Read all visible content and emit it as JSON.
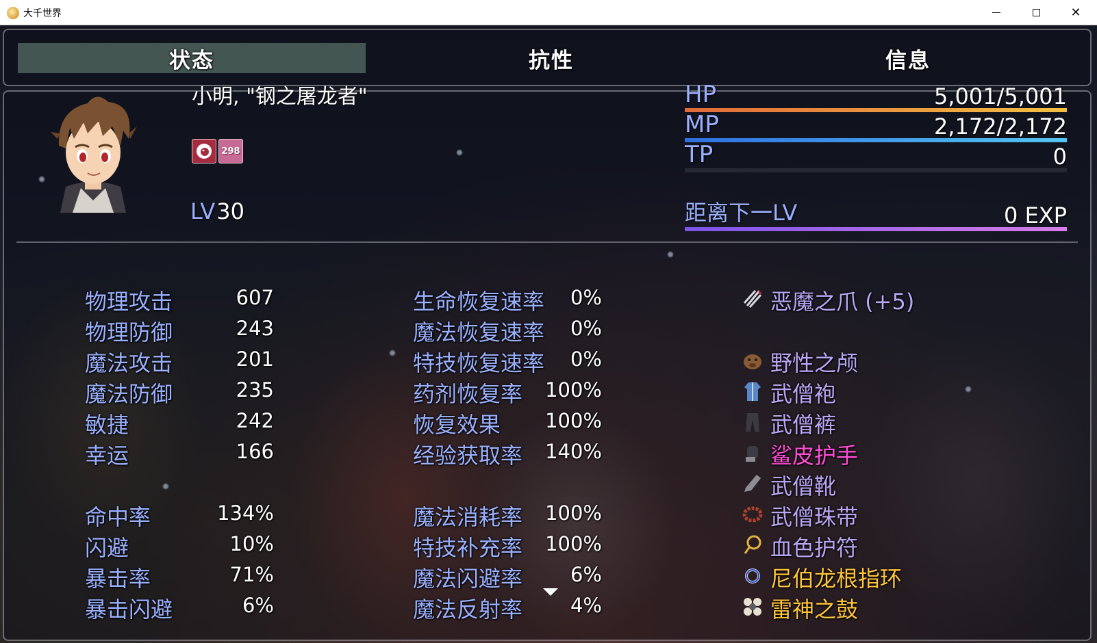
{
  "window": {
    "title": "大千世界"
  },
  "tabs": [
    {
      "label": "状态",
      "active": true
    },
    {
      "label": "抗性",
      "active": false
    },
    {
      "label": "信息",
      "active": false
    }
  ],
  "character": {
    "name": "小明, \"钢之屠龙者\"",
    "state_counter": "298",
    "level_label": "LV",
    "level_value": "30"
  },
  "gauges": {
    "hp": {
      "label": "HP",
      "value": "5,001/5,001",
      "fill": 1.0,
      "color_from": "#e06a3a",
      "color_to": "#f3c043"
    },
    "mp": {
      "label": "MP",
      "value": "2,172/2,172",
      "fill": 1.0,
      "color_from": "#2f6fe0",
      "color_to": "#54c6f2"
    },
    "tp": {
      "label": "TP",
      "value": "0",
      "fill": 0.0,
      "color_from": "#3da84a",
      "color_to": "#a6e05a"
    },
    "exp": {
      "label": "距离下一LV",
      "value": "0 EXP",
      "fill": 1.0,
      "color_from": "#7a53e8",
      "color_to": "#d67de8"
    }
  },
  "params": [
    {
      "label": "物理攻击",
      "value": "607"
    },
    {
      "label": "物理防御",
      "value": "243"
    },
    {
      "label": "魔法攻击",
      "value": "201"
    },
    {
      "label": "魔法防御",
      "value": "235"
    },
    {
      "label": "敏捷",
      "value": "242"
    },
    {
      "label": "幸运",
      "value": "166"
    }
  ],
  "xparams": [
    {
      "label": "命中率",
      "value": "134%"
    },
    {
      "label": "闪避",
      "value": "10%"
    },
    {
      "label": "暴击率",
      "value": "71%"
    },
    {
      "label": "暴击闪避",
      "value": "6%"
    }
  ],
  "regen": [
    {
      "label": "生命恢复速率",
      "value": "0%"
    },
    {
      "label": "魔法恢复速率",
      "value": "0%"
    },
    {
      "label": "特技恢复速率",
      "value": "0%"
    },
    {
      "label": "药剂恢复率",
      "value": "100%"
    },
    {
      "label": "恢复效果",
      "value": "100%"
    },
    {
      "label": "经验获取率",
      "value": "140%"
    }
  ],
  "sparams": [
    {
      "label": "魔法消耗率",
      "value": "100%"
    },
    {
      "label": "特技补充率",
      "value": "100%"
    },
    {
      "label": "魔法闪避率",
      "value": "6%"
    },
    {
      "label": "魔法反射率",
      "value": "4%"
    }
  ],
  "equipment": [
    {
      "icon": "claw-icon",
      "name": "恶魔之爪 (+5)",
      "color": "#b9a7f5"
    },
    {
      "icon": "boar-head-icon",
      "name": "野性之颅",
      "color": "#b9a7f5"
    },
    {
      "icon": "robe-icon",
      "name": "武僧袍",
      "color": "#b9a7f5"
    },
    {
      "icon": "pants-icon",
      "name": "武僧裤",
      "color": "#b9a7f5"
    },
    {
      "icon": "gauntlet-icon",
      "name": "鲨皮护手",
      "color": "#ff4fd6"
    },
    {
      "icon": "boot-icon",
      "name": "武僧靴",
      "color": "#b9a7f5"
    },
    {
      "icon": "bead-belt-icon",
      "name": "武僧珠带",
      "color": "#b9a7f5"
    },
    {
      "icon": "amulet-icon",
      "name": "血色护符",
      "color": "#b9a7f5"
    },
    {
      "icon": "ring-icon",
      "name": "尼伯龙根指环",
      "color": "#ffc53d"
    },
    {
      "icon": "drum-icon",
      "name": "雷神之鼓",
      "color": "#ffc53d"
    }
  ],
  "colors": {
    "system_label": "#9ab0ff",
    "active_tab": "#566e64",
    "text": "#ffffff"
  }
}
